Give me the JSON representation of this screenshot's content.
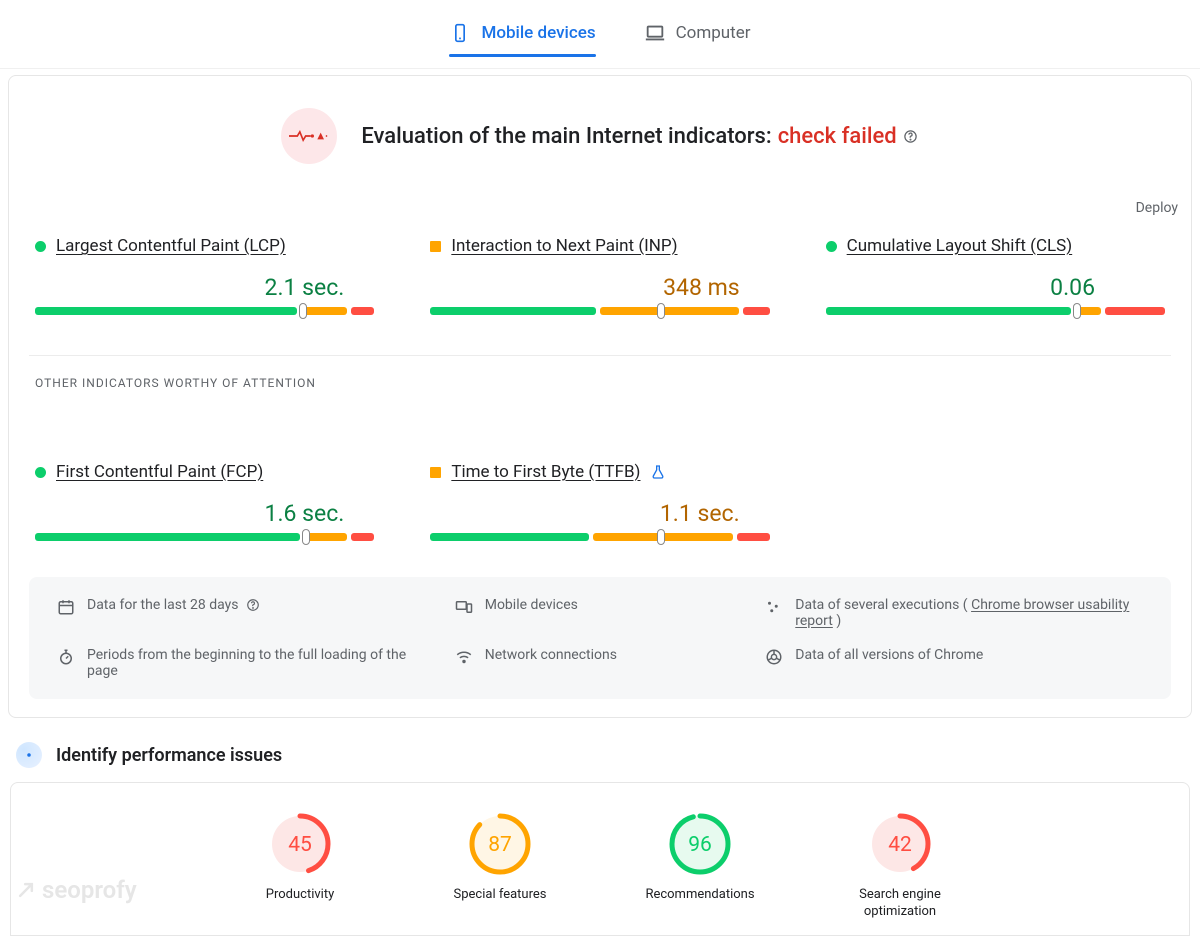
{
  "tabs": {
    "mobile": "Mobile devices",
    "computer": "Computer"
  },
  "eval": {
    "title_prefix": "Evaluation of the main Internet indicators:",
    "status_text": "check failed"
  },
  "deploy_label": "Deploy",
  "core_metrics": [
    {
      "name": "Largest Contentful Paint (LCP)",
      "value": "2.1 sec.",
      "status": "green",
      "marker_pct": 79,
      "segs": [
        79,
        14,
        7
      ]
    },
    {
      "name": "Interaction to Next Paint (INP)",
      "value": "348 ms",
      "status": "orange",
      "marker_pct": 68,
      "segs": [
        50,
        42,
        8
      ]
    },
    {
      "name": "Cumulative Layout Shift (CLS)",
      "value": "0.06",
      "status": "green",
      "marker_pct": 74,
      "segs": [
        74,
        8,
        18
      ],
      "value_pad": "70px"
    }
  ],
  "other_label": "OTHER INDICATORS WORTHY OF ATTENTION",
  "other_metrics": [
    {
      "name": "First Contentful Paint (FCP)",
      "value": "1.6 sec.",
      "status": "green",
      "marker_pct": 80,
      "segs": [
        80,
        13,
        7
      ]
    },
    {
      "name": "Time to First Byte (TTFB)",
      "value": "1.1 sec.",
      "status": "orange",
      "marker_pct": 68,
      "segs": [
        48,
        42,
        10
      ],
      "lab": true
    }
  ],
  "info": {
    "data_28": "Data for the last 28 days",
    "periods": "Periods from the beginning to the full loading of the page",
    "mobile": "Mobile devices",
    "network": "Network connections",
    "executions": "Data of several executions (",
    "chrome_report": "Chrome browser usability report",
    "paren_close": ")",
    "all_chrome": "Data of all versions of Chrome"
  },
  "identify": {
    "title": "Identify performance issues",
    "gauges": [
      {
        "label": "Productivity",
        "score": 45,
        "color": "#ff4e42",
        "bg": "#fde7e6"
      },
      {
        "label": "Special features",
        "score": 87,
        "color": "#ffa400",
        "bg": "#fff6e5"
      },
      {
        "label": "Recommendations",
        "score": 96,
        "color": "#0cce6b",
        "bg": "#e7faef"
      },
      {
        "label": "Search engine optimization",
        "score": 42,
        "color": "#ff4e42",
        "bg": "#fde7e6"
      }
    ]
  },
  "watermark": "seoprofy"
}
